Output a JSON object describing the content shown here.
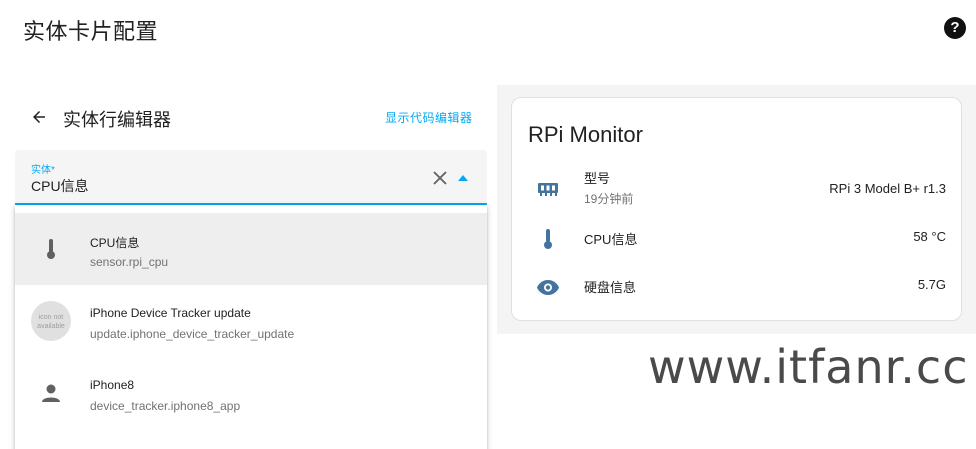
{
  "dialog": {
    "title": "实体卡片配置",
    "help_icon": "help-circle-icon"
  },
  "editor": {
    "back_icon": "arrow-left-icon",
    "title": "实体行编辑器",
    "code_editor_link": "显示代码编辑器"
  },
  "entity_field": {
    "label": "实体*",
    "value": "CPU信息",
    "clear_icon": "close-icon",
    "toggle_icon": "caret-up-icon"
  },
  "dropdown": {
    "items": [
      {
        "name": "CPU信息",
        "entity_id": "sensor.rpi_cpu",
        "icon": "thermometer-icon",
        "selected": true
      },
      {
        "name": "iPhone Device Tracker update",
        "entity_id": "update.iphone_device_tracker_update",
        "icon": "avatar-image",
        "avatar_text": "icon not available"
      },
      {
        "name": "iPhone8",
        "entity_id": "device_tracker.iphone8_app",
        "icon": "account-icon"
      }
    ]
  },
  "preview_card": {
    "title": "RPi Monitor",
    "rows": [
      {
        "name": "型号",
        "secondary": "19分钟前",
        "value": "RPi 3 Model B+ r1.3",
        "icon": "memory-board-icon"
      },
      {
        "name": "CPU信息",
        "value": "58 °C",
        "icon": "thermometer-icon"
      },
      {
        "name": "硬盘信息",
        "value": "5.7G",
        "icon": "eye-icon"
      }
    ]
  },
  "watermark": "www.itfanr.cc",
  "colors": {
    "accent": "#03a9f4",
    "icon": "#44739e",
    "text": "#212121",
    "secondary_text": "#727272"
  }
}
